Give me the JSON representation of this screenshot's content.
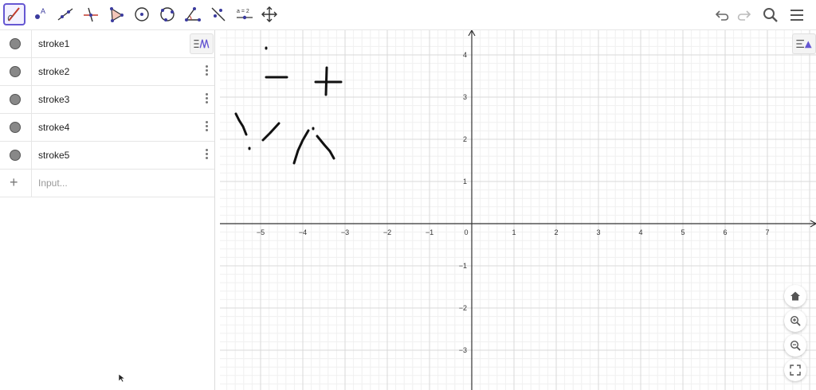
{
  "toolbar": {
    "tools": [
      "pen-tool",
      "point-tool",
      "line-tool",
      "perpendicular-line-tool",
      "polygon-tool",
      "circle-center-tool",
      "circle-three-points-tool",
      "angle-tool",
      "reflect-tool",
      "slider-tool",
      "move-graphics-view-tool"
    ],
    "slider_label": "a = 2",
    "right": [
      "undo",
      "redo",
      "search",
      "menu"
    ]
  },
  "algebra": {
    "items": [
      {
        "label": "stroke1"
      },
      {
        "label": "stroke2"
      },
      {
        "label": "stroke3"
      },
      {
        "label": "stroke4"
      },
      {
        "label": "stroke5"
      }
    ],
    "input_placeholder": "Input..."
  },
  "graphics": {
    "x_ticks": [
      "−5",
      "−4",
      "−3",
      "−2",
      "−1",
      "0",
      "1",
      "2",
      "3",
      "4",
      "5",
      "6",
      "7"
    ],
    "y_ticks_pos": [
      "4",
      "3",
      "2",
      "1"
    ],
    "y_ticks_neg": [
      "−1",
      "−2",
      "−3"
    ],
    "x_range": [
      -6.2,
      8.0
    ],
    "y_range": [
      -3.8,
      4.6
    ],
    "grid": true
  },
  "colors": {
    "accent": "#6557d2",
    "dot": "#888888"
  }
}
